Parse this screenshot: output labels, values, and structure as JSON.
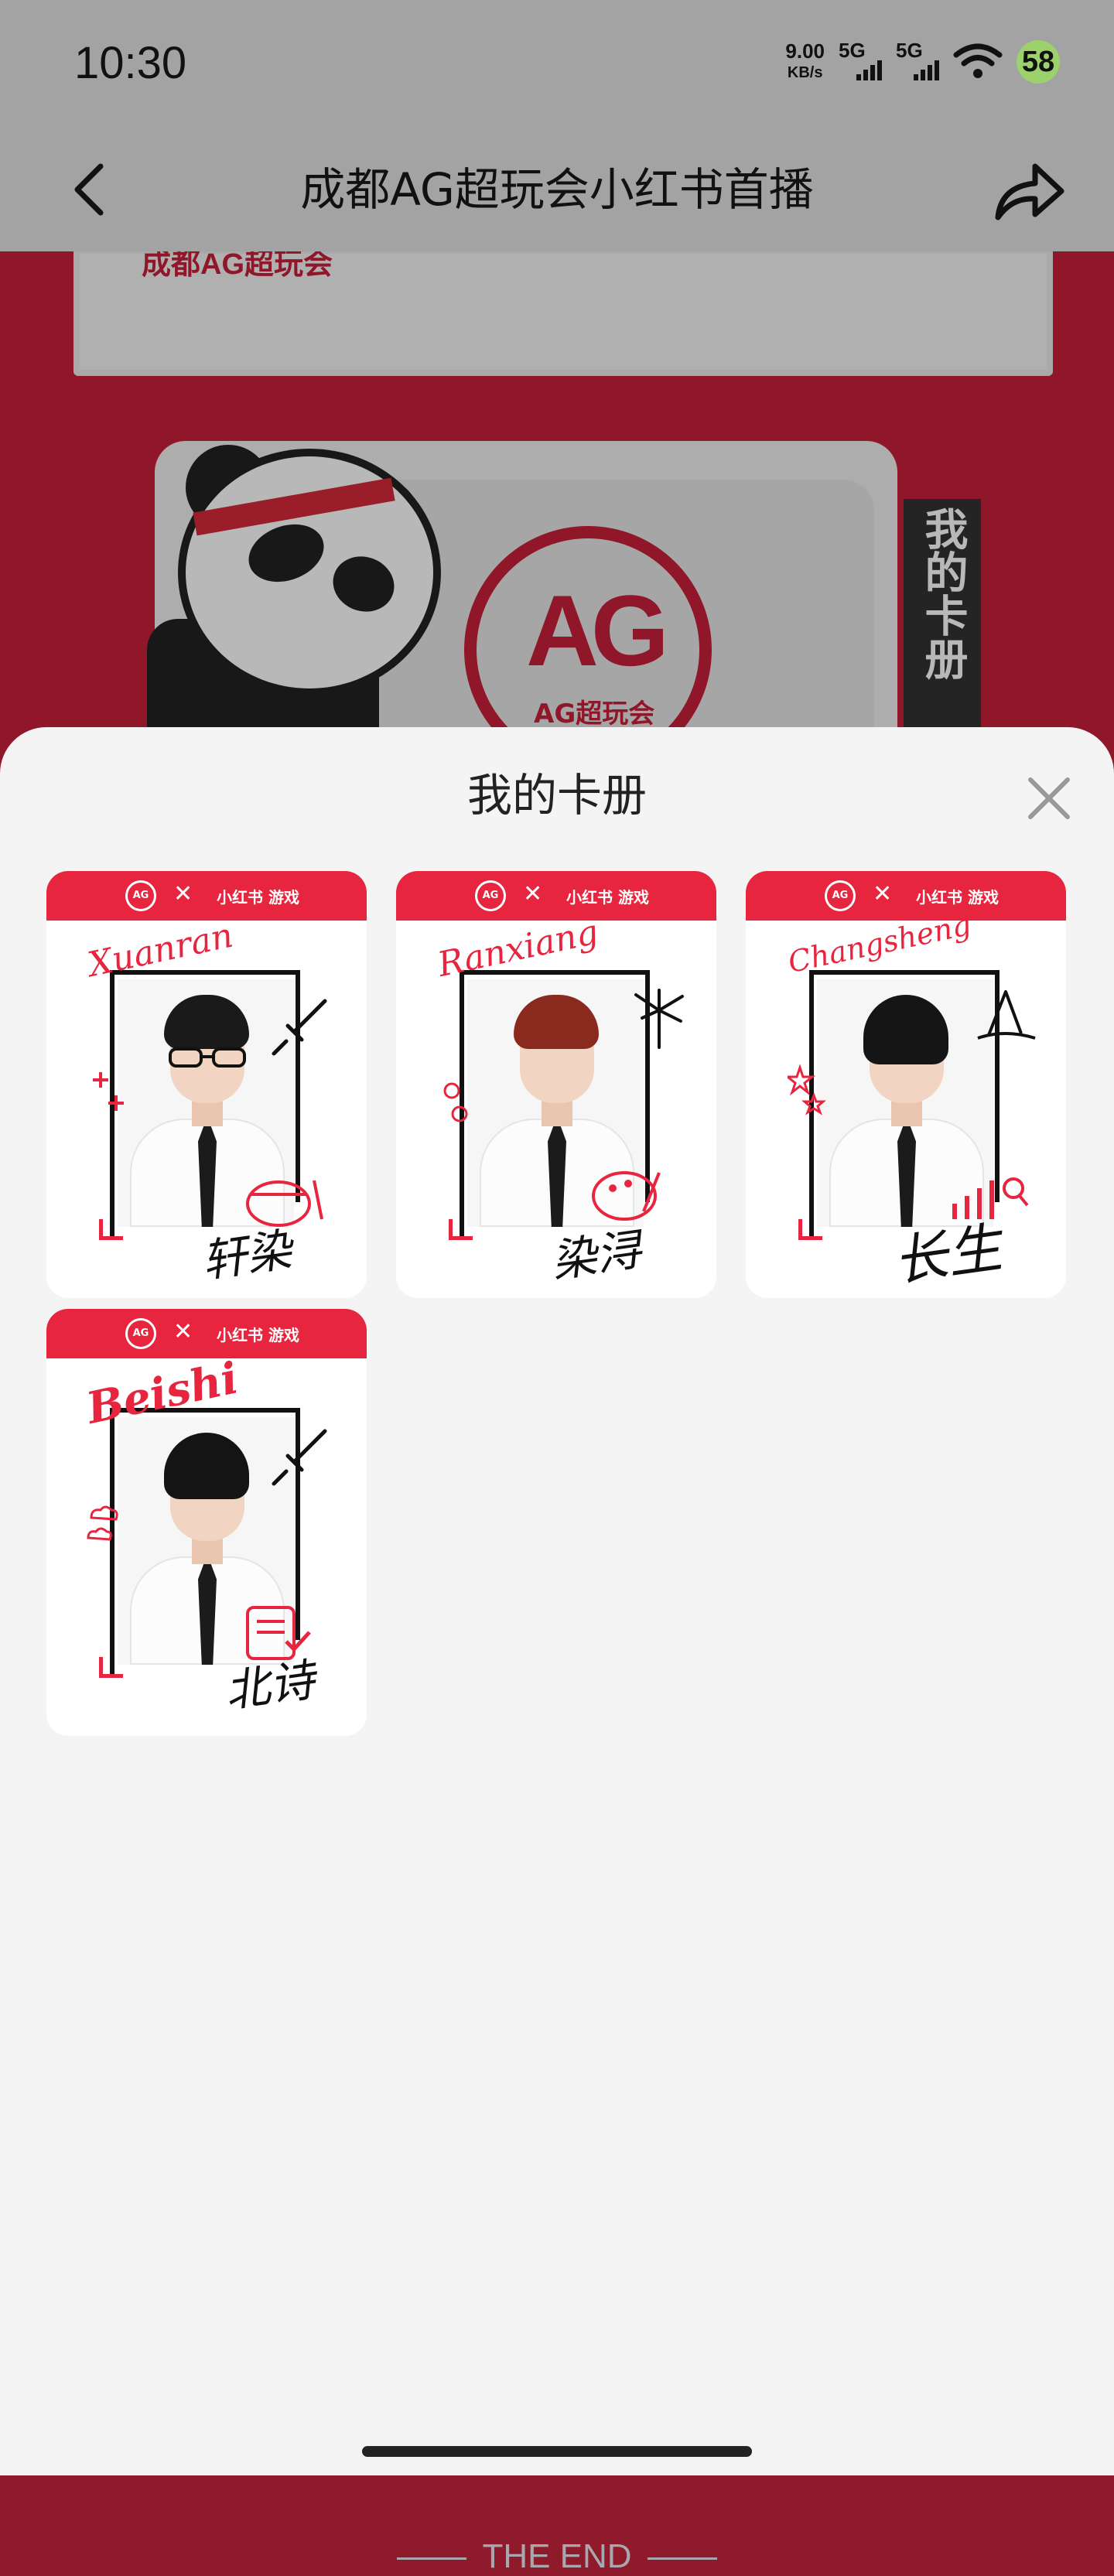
{
  "status_bar": {
    "time": "10:30",
    "net_speed_value": "9.00",
    "net_speed_unit": "KB/s",
    "signal_1_label": "5G",
    "signal_2_label": "5G",
    "battery": "58",
    "wifi_icon": "wifi-icon"
  },
  "nav": {
    "title": "成都AG超玩会小红书首播",
    "back_icon": "back-arrow-icon",
    "share_icon": "share-icon"
  },
  "background": {
    "banner_text": "成都AG超玩会",
    "logo_text": "AG",
    "logo_sub": "AG超玩会",
    "vertical_label": "我的卡册"
  },
  "sheet": {
    "title": "我的卡册",
    "close_icon": "close-icon",
    "cards": [
      {
        "header_logo": "AG",
        "header_x": "✕",
        "header_brand": "小红书 游戏",
        "name": "Xuanran",
        "signature": "轩染",
        "hair_color": "#1a1a1a"
      },
      {
        "header_logo": "AG",
        "header_x": "✕",
        "header_brand": "小红书 游戏",
        "name": "Ranxiang",
        "signature": "染浔",
        "hair_color": "#8a2a1e"
      },
      {
        "header_logo": "AG",
        "header_x": "✕",
        "header_brand": "小红书 游戏",
        "name": "Changsheng",
        "signature": "长生",
        "hair_color": "#151515"
      },
      {
        "header_logo": "AG",
        "header_x": "✕",
        "header_brand": "小红书 游戏",
        "name": "Beishi",
        "signature": "北诗",
        "hair_color": "#141414"
      }
    ],
    "end_text": "THE END"
  },
  "colors": {
    "accent_red": "#e8253e",
    "sheet_bg": "#f4f4f4",
    "dim_bar": "#a3a3a3"
  }
}
